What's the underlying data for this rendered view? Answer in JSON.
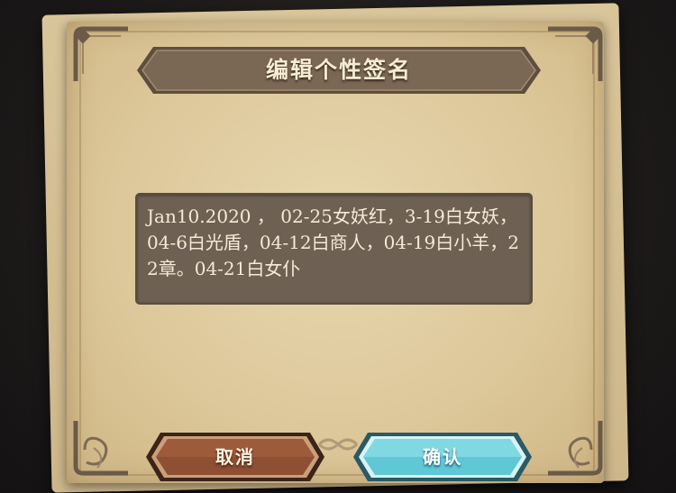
{
  "dialog": {
    "title": "编辑个性签名",
    "signature_text": "Jan10.2020 ， 02-25女妖红，3-19白女妖，04-6白光盾，04-12白商人，04-19白小羊，22章。04-21白女仆"
  },
  "buttons": {
    "cancel_label": "取消",
    "confirm_label": "确认"
  },
  "colors": {
    "parchment": "#dcc799",
    "banner": "#7a6754",
    "text_box": "#6e6052",
    "cancel_button": "#8e4f35",
    "confirm_button": "#5fc7d6"
  }
}
